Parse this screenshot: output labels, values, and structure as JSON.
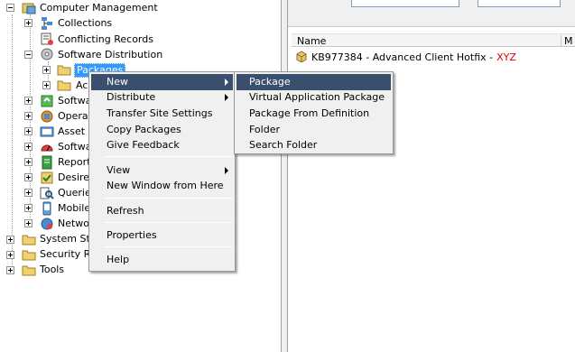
{
  "tree": {
    "items": [
      {
        "label": "Computer Management",
        "icon": "computer-management-icon"
      },
      {
        "label": "Collections",
        "icon": "collections-icon"
      },
      {
        "label": "Conflicting Records",
        "icon": "conflicting-records-icon"
      },
      {
        "label": "Software Distribution",
        "icon": "software-distribution-icon"
      },
      {
        "label": "Packages",
        "icon": "packages-folder-icon"
      },
      {
        "label": "Ac",
        "icon": "advertisements-icon"
      },
      {
        "label": "Softwa",
        "icon": "software-updates-icon"
      },
      {
        "label": "Opera",
        "icon": "operating-system-icon"
      },
      {
        "label": "Asset",
        "icon": "asset-intelligence-icon"
      },
      {
        "label": "Softwa",
        "icon": "software-metering-icon"
      },
      {
        "label": "Report",
        "icon": "reporting-icon"
      },
      {
        "label": "Desire",
        "icon": "desired-config-icon"
      },
      {
        "label": "Querie",
        "icon": "queries-icon"
      },
      {
        "label": "Mobile",
        "icon": "mobile-device-icon"
      },
      {
        "label": "Netwo",
        "icon": "network-access-icon"
      },
      {
        "label": "System Sta",
        "icon": "system-status-icon"
      },
      {
        "label": "Security R",
        "icon": "security-rights-icon"
      },
      {
        "label": "Tools",
        "icon": "tools-icon"
      }
    ]
  },
  "list": {
    "columns": [
      "Name",
      "M"
    ],
    "rows": [
      {
        "name": "KB977384 - Advanced Client Hotfix -",
        "tag": "XYZ",
        "tag_color": "#e00000",
        "icon": "package-icon"
      }
    ]
  },
  "context_menu": {
    "items": [
      "New",
      "Distribute",
      "Transfer Site Settings",
      "Copy Packages",
      "Give Feedback",
      "View",
      "New Window from Here",
      "Refresh",
      "Properties",
      "Help"
    ],
    "highlighted": "New"
  },
  "submenu": {
    "items": [
      "Package",
      "Virtual Application Package",
      "Package From Definition",
      "Folder",
      "Search Folder"
    ],
    "highlighted": "Package"
  },
  "colors": {
    "menu_highlight": "#3a4f6e",
    "selection": "#3399ff",
    "accent_red": "#e00000"
  }
}
